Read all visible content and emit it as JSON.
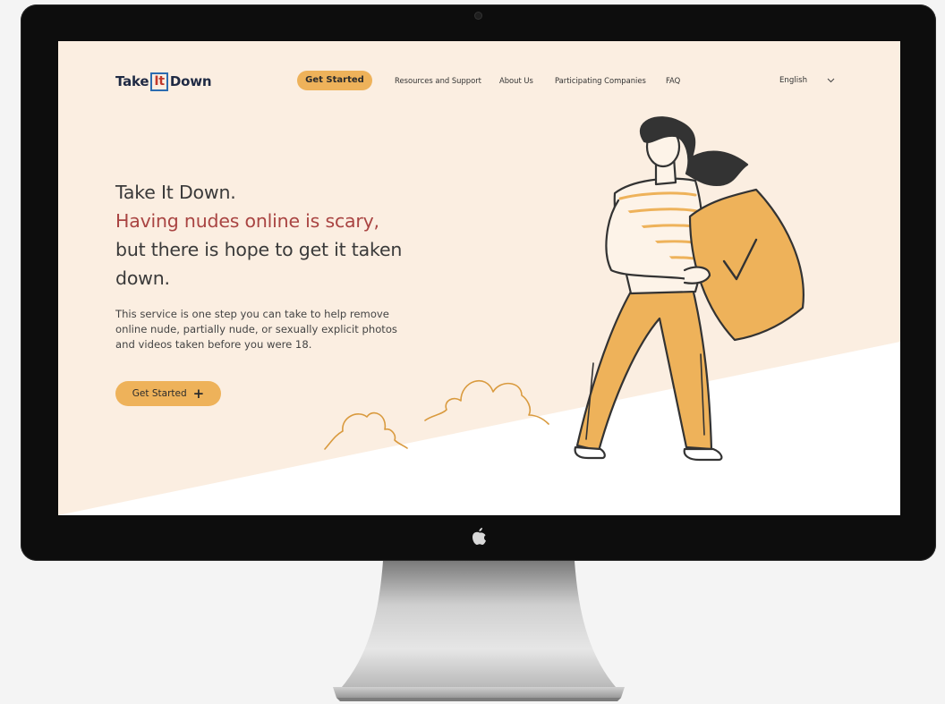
{
  "nav": {
    "logo_left": "Take",
    "logo_boxed": "It",
    "logo_right": "Down",
    "cta_label": "Get Started",
    "links": [
      "Resources and Support",
      "About Us",
      "Participating Companies",
      "FAQ"
    ],
    "language": "English"
  },
  "hero": {
    "line1": "Take It Down.",
    "line2": "Having nudes online is scary,",
    "line3": "but there is hope to get it taken",
    "line4": "down.",
    "body_line1": "This service is one step you can take to help remove",
    "body_line2": "online nude, partially nude, or sexually explicit photos",
    "body_line3": "and videos taken before you were 18.",
    "cta_label": "Get Started",
    "cta_icon": "plus-icon"
  },
  "colors": {
    "screen_bg": "#fbeee1",
    "accent": "#eeb25a",
    "headline_red": "#a94442",
    "logo_navy": "#1f2a44",
    "logo_box": "#2b6cb0",
    "bezel": "#0d0d0d"
  },
  "illustration": {
    "subject": "woman-holding-shield-icon",
    "shield": "shield-check-icon",
    "decor": "clouds-icon"
  }
}
